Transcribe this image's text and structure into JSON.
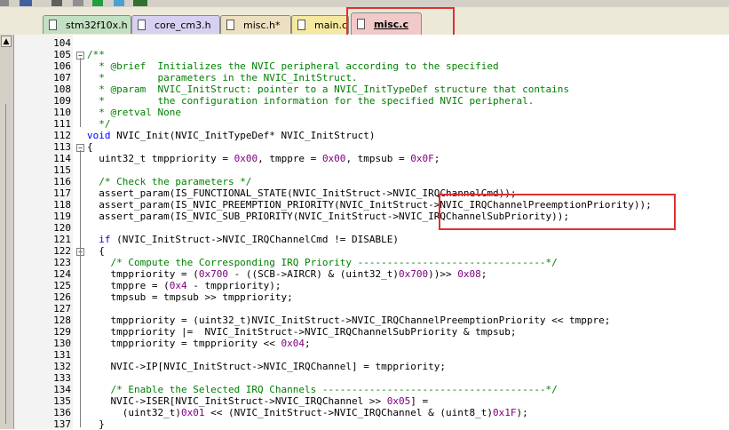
{
  "tabs": [
    {
      "label": "stm32f10x.h",
      "color": "#c2e0c2",
      "active": false
    },
    {
      "label": "core_cm3.h",
      "color": "#d7d0f0",
      "active": false
    },
    {
      "label": "misc.h*",
      "color": "#ece0c0",
      "active": false
    },
    {
      "label": "main.c",
      "color": "#f5e8a0",
      "active": false
    },
    {
      "label": "misc.c",
      "color": "#f2c9c9",
      "active": true
    }
  ],
  "colors": {
    "comment": "#008000",
    "keyword": "#0000ff",
    "number": "#800080",
    "highlight_box": "#e03030"
  },
  "lines": [
    {
      "n": "104",
      "parts": []
    },
    {
      "n": "105",
      "parts": [
        {
          "t": "/**",
          "c": "cmt"
        }
      ]
    },
    {
      "n": "106",
      "parts": [
        {
          "t": "  * @brief  Initializes the NVIC peripheral according to the specified",
          "c": "cmt"
        }
      ]
    },
    {
      "n": "107",
      "parts": [
        {
          "t": "  *         parameters in the NVIC_InitStruct.",
          "c": "cmt"
        }
      ]
    },
    {
      "n": "108",
      "parts": [
        {
          "t": "  * @param  NVIC_InitStruct: pointer to a NVIC_InitTypeDef structure that contains",
          "c": "cmt"
        }
      ]
    },
    {
      "n": "109",
      "parts": [
        {
          "t": "  *         the configuration information for the specified NVIC peripheral.",
          "c": "cmt"
        }
      ]
    },
    {
      "n": "110",
      "parts": [
        {
          "t": "  * @retval None",
          "c": "cmt"
        }
      ]
    },
    {
      "n": "111",
      "parts": [
        {
          "t": "  */",
          "c": "cmt"
        }
      ]
    },
    {
      "n": "112",
      "parts": [
        {
          "t": "void",
          "c": "kw"
        },
        {
          "t": " NVIC_Init(NVIC_InitTypeDef* NVIC_InitStruct)",
          "c": ""
        }
      ]
    },
    {
      "n": "113",
      "parts": [
        {
          "t": "{",
          "c": ""
        }
      ]
    },
    {
      "n": "114",
      "parts": [
        {
          "t": "  uint32_t tmppriority = ",
          "c": ""
        },
        {
          "t": "0x00",
          "c": "num"
        },
        {
          "t": ", tmppre = ",
          "c": ""
        },
        {
          "t": "0x00",
          "c": "num"
        },
        {
          "t": ", tmpsub = ",
          "c": ""
        },
        {
          "t": "0x0F",
          "c": "num"
        },
        {
          "t": ";",
          "c": ""
        }
      ]
    },
    {
      "n": "115",
      "parts": []
    },
    {
      "n": "116",
      "parts": [
        {
          "t": "  /* Check the parameters */",
          "c": "cmt"
        }
      ]
    },
    {
      "n": "117",
      "parts": [
        {
          "t": "  assert_param(IS_FUNCTIONAL_STATE(NVIC_InitStruct->NVIC_IRQChannelCmd));",
          "c": ""
        }
      ]
    },
    {
      "n": "118",
      "parts": [
        {
          "t": "  assert_param(IS_NVIC_PREEMPTION_PRIORITY(NVIC_InitStruct->NVIC_IRQChannelPreemptionPriority));",
          "c": ""
        }
      ]
    },
    {
      "n": "119",
      "parts": [
        {
          "t": "  assert_param(IS_NVIC_SUB_PRIORITY(NVIC_InitStruct->NVIC_IRQChannelSubPriority));",
          "c": ""
        }
      ]
    },
    {
      "n": "120",
      "parts": []
    },
    {
      "n": "121",
      "parts": [
        {
          "t": "  ",
          "c": ""
        },
        {
          "t": "if",
          "c": "kw"
        },
        {
          "t": " (NVIC_InitStruct->NVIC_IRQChannelCmd != DISABLE)",
          "c": ""
        }
      ]
    },
    {
      "n": "122",
      "parts": [
        {
          "t": "  {",
          "c": ""
        }
      ]
    },
    {
      "n": "123",
      "parts": [
        {
          "t": "    /* Compute the Corresponding IRQ Priority --------------------------------*/",
          "c": "cmt"
        }
      ]
    },
    {
      "n": "124",
      "parts": [
        {
          "t": "    tmppriority = (",
          "c": ""
        },
        {
          "t": "0x700",
          "c": "num"
        },
        {
          "t": " - ((SCB->AIRCR) & (uint32_t)",
          "c": ""
        },
        {
          "t": "0x700",
          "c": "num"
        },
        {
          "t": "))>> ",
          "c": ""
        },
        {
          "t": "0x08",
          "c": "num"
        },
        {
          "t": ";",
          "c": ""
        }
      ]
    },
    {
      "n": "125",
      "parts": [
        {
          "t": "    tmppre = (",
          "c": ""
        },
        {
          "t": "0x4",
          "c": "num"
        },
        {
          "t": " - tmppriority);",
          "c": ""
        }
      ]
    },
    {
      "n": "126",
      "parts": [
        {
          "t": "    tmpsub = tmpsub >> tmppriority;",
          "c": ""
        }
      ]
    },
    {
      "n": "127",
      "parts": []
    },
    {
      "n": "128",
      "parts": [
        {
          "t": "    tmppriority = (uint32_t)NVIC_InitStruct->NVIC_IRQChannelPreemptionPriority << tmppre;",
          "c": ""
        }
      ]
    },
    {
      "n": "129",
      "parts": [
        {
          "t": "    tmppriority |=  NVIC_InitStruct->NVIC_IRQChannelSubPriority & tmpsub;",
          "c": ""
        }
      ]
    },
    {
      "n": "130",
      "parts": [
        {
          "t": "    tmppriority = tmppriority << ",
          "c": ""
        },
        {
          "t": "0x04",
          "c": "num"
        },
        {
          "t": ";",
          "c": ""
        }
      ]
    },
    {
      "n": "131",
      "parts": []
    },
    {
      "n": "132",
      "parts": [
        {
          "t": "    NVIC->IP[NVIC_InitStruct->NVIC_IRQChannel] = tmppriority;",
          "c": ""
        }
      ]
    },
    {
      "n": "133",
      "parts": []
    },
    {
      "n": "134",
      "parts": [
        {
          "t": "    /* Enable the Selected IRQ Channels --------------------------------------*/",
          "c": "cmt"
        }
      ]
    },
    {
      "n": "135",
      "parts": [
        {
          "t": "    NVIC->ISER[NVIC_InitStruct->NVIC_IRQChannel >> ",
          "c": ""
        },
        {
          "t": "0x05",
          "c": "num"
        },
        {
          "t": "] =",
          "c": ""
        }
      ]
    },
    {
      "n": "136",
      "parts": [
        {
          "t": "      (uint32_t)",
          "c": ""
        },
        {
          "t": "0x01",
          "c": "num"
        },
        {
          "t": " << (NVIC_InitStruct->NVIC_IRQChannel & (uint8_t)",
          "c": ""
        },
        {
          "t": "0x1F",
          "c": "num"
        },
        {
          "t": ");",
          "c": ""
        }
      ]
    },
    {
      "n": "137",
      "parts": [
        {
          "t": "  }",
          "c": ""
        }
      ]
    }
  ]
}
